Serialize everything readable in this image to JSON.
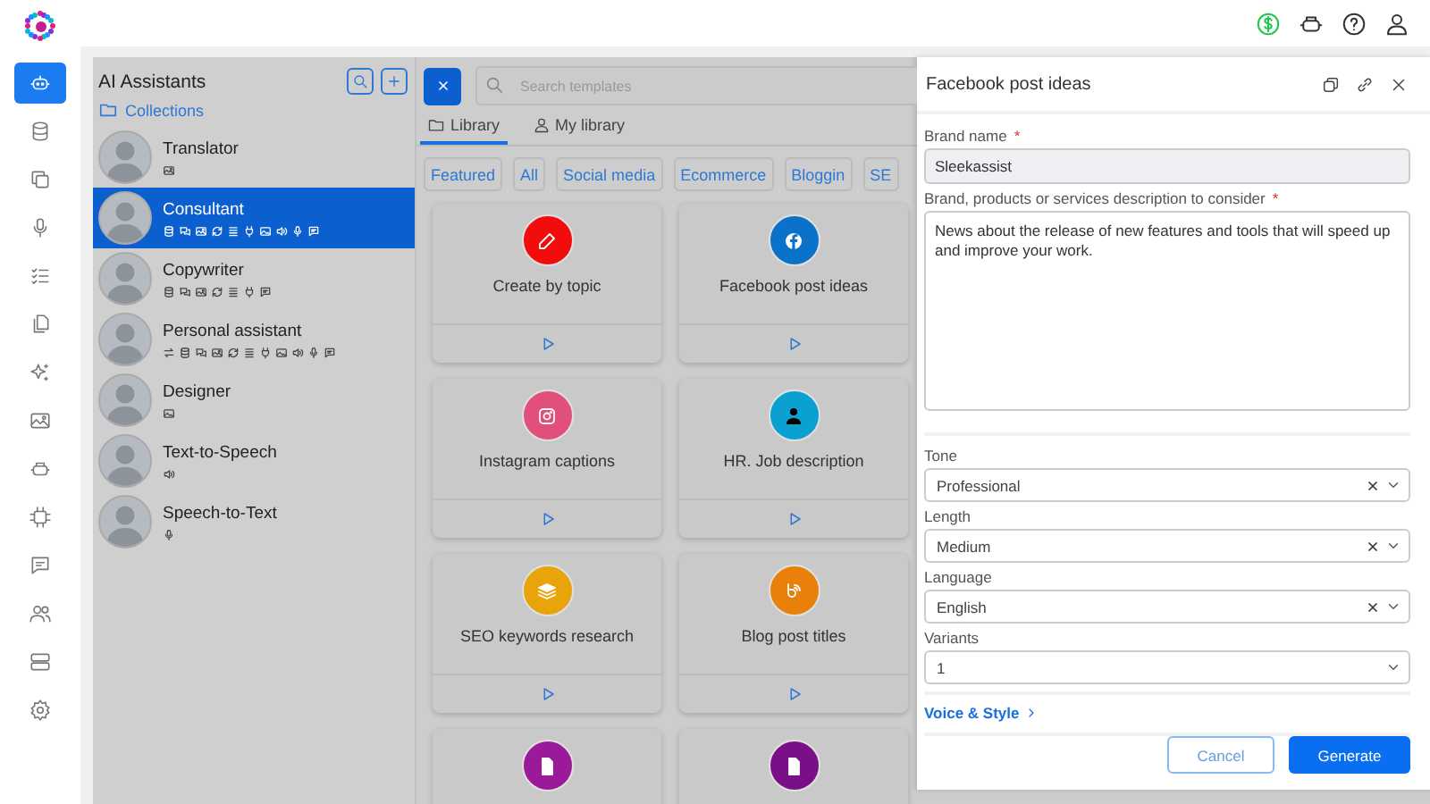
{
  "sidebar": {
    "items": [
      {
        "kind": "bot",
        "selected": true
      },
      {
        "kind": "database",
        "selected": false
      },
      {
        "kind": "copy",
        "selected": false
      },
      {
        "kind": "mic",
        "selected": false
      },
      {
        "kind": "checklist",
        "selected": false
      },
      {
        "kind": "files",
        "selected": false
      },
      {
        "kind": "sparkle",
        "selected": false
      },
      {
        "kind": "image",
        "selected": false
      },
      {
        "kind": "robot",
        "selected": false
      },
      {
        "kind": "chip",
        "selected": false
      },
      {
        "kind": "comment",
        "selected": false
      },
      {
        "kind": "users",
        "selected": false
      },
      {
        "kind": "server",
        "selected": false
      },
      {
        "kind": "gear",
        "selected": false
      }
    ]
  },
  "assistants": {
    "title": "AI Assistants",
    "collections_link": "Collections",
    "items": [
      {
        "name": "Translator",
        "selected": false,
        "tools": [
          {
            "kind": "image"
          }
        ]
      },
      {
        "name": "Consultant",
        "selected": true,
        "tools": [
          {
            "kind": "database"
          },
          {
            "kind": "chat"
          },
          {
            "kind": "image"
          },
          {
            "kind": "sync"
          },
          {
            "kind": "list"
          },
          {
            "kind": "plug"
          },
          {
            "kind": "gallery"
          },
          {
            "kind": "speaker"
          },
          {
            "kind": "mic"
          },
          {
            "kind": "comment"
          }
        ]
      },
      {
        "name": "Copywriter",
        "selected": false,
        "tools": [
          {
            "kind": "database"
          },
          {
            "kind": "chat"
          },
          {
            "kind": "image"
          },
          {
            "kind": "sync"
          },
          {
            "kind": "list"
          },
          {
            "kind": "plug"
          },
          {
            "kind": "comment"
          }
        ]
      },
      {
        "name": "Personal assistant",
        "selected": false,
        "tools": [
          {
            "kind": "swap"
          },
          {
            "kind": "database"
          },
          {
            "kind": "chat"
          },
          {
            "kind": "image"
          },
          {
            "kind": "sync"
          },
          {
            "kind": "list"
          },
          {
            "kind": "plug"
          },
          {
            "kind": "gallery"
          },
          {
            "kind": "speaker"
          },
          {
            "kind": "mic"
          },
          {
            "kind": "comment"
          }
        ]
      },
      {
        "name": "Designer",
        "selected": false,
        "tools": [
          {
            "kind": "gallery"
          }
        ]
      },
      {
        "name": "Text-to-Speech",
        "selected": false,
        "tools": [
          {
            "kind": "speaker"
          }
        ]
      },
      {
        "name": "Speech-to-Text",
        "selected": false,
        "tools": [
          {
            "kind": "mic"
          }
        ]
      }
    ]
  },
  "templates": {
    "search": {
      "placeholder": "Search templates"
    },
    "tabs": [
      {
        "label": "Library",
        "kind": "folder",
        "selected": true
      },
      {
        "label": "My library",
        "kind": "user",
        "selected": false
      }
    ],
    "filters": [
      "Featured",
      "All",
      "Social media",
      "Ecommerce",
      "Bloggin",
      "SE"
    ],
    "cards": [
      {
        "title": "Create by topic",
        "kind": "pencil",
        "color": "#f20c0c"
      },
      {
        "title": "Facebook post ideas",
        "kind": "facebook",
        "color": "#0a72c8"
      },
      {
        "title": "Instagram captions",
        "kind": "instagram",
        "color": "#e0507a"
      },
      {
        "title": "HR. Job description",
        "kind": "person",
        "color": "#0aa0d0"
      },
      {
        "title": "SEO keywords research",
        "kind": "layers",
        "color": "#e8a40a"
      },
      {
        "title": "Blog post titles",
        "kind": "blog",
        "color": "#e8800a"
      },
      {
        "kind": "document",
        "color": "#9a1a9a"
      },
      {
        "kind": "document",
        "color": "#7a1088"
      }
    ]
  },
  "drawer": {
    "title": "Facebook post ideas",
    "fields": [
      {
        "kind": "text",
        "label": "Brand name",
        "required_mark": "*",
        "value": "Sleekassist"
      },
      {
        "kind": "textarea",
        "label": "Brand, products or services description to consider",
        "required_mark": "*",
        "value": "News about the release of new features and tools that will speed up and improve your work."
      },
      {
        "kind": "select",
        "label": "Tone",
        "value": "Professional",
        "clearable": true
      },
      {
        "kind": "select",
        "label": "Length",
        "value": "Medium",
        "clearable": true
      },
      {
        "kind": "select",
        "label": "Language",
        "value": "English",
        "clearable": true
      },
      {
        "kind": "select",
        "label": "Variants",
        "value": "1",
        "clearable": false
      }
    ],
    "voice_link": "Voice & Style",
    "buttons": [
      {
        "label": "Cancel",
        "kind": "secondary"
      },
      {
        "label": "Generate",
        "kind": "primary"
      }
    ]
  }
}
